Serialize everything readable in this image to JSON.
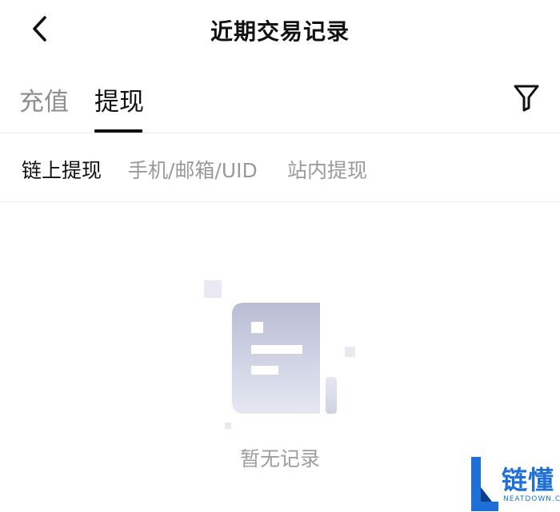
{
  "header": {
    "title": "近期交易记录",
    "back_icon": "chevron-left-icon"
  },
  "tabs": [
    {
      "label": "充值",
      "active": false
    },
    {
      "label": "提现",
      "active": true
    }
  ],
  "filter_icon": "filter-funnel-icon",
  "subtabs": [
    {
      "label": "链上提现",
      "active": true
    },
    {
      "label": "手机/邮箱/UID",
      "active": false
    },
    {
      "label": "站内提现",
      "active": false
    }
  ],
  "empty_state": {
    "text": "暂无记录",
    "icon": "empty-document-icon"
  },
  "watermark": {
    "cn": "链懂",
    "en": "NEATDOWN.COM"
  },
  "colors": {
    "text_primary": "#111111",
    "text_inactive": "#8f8f8f",
    "divider": "#ececec",
    "illustration": "#c9cbe0",
    "watermark_blue": "#1f6fd8"
  }
}
